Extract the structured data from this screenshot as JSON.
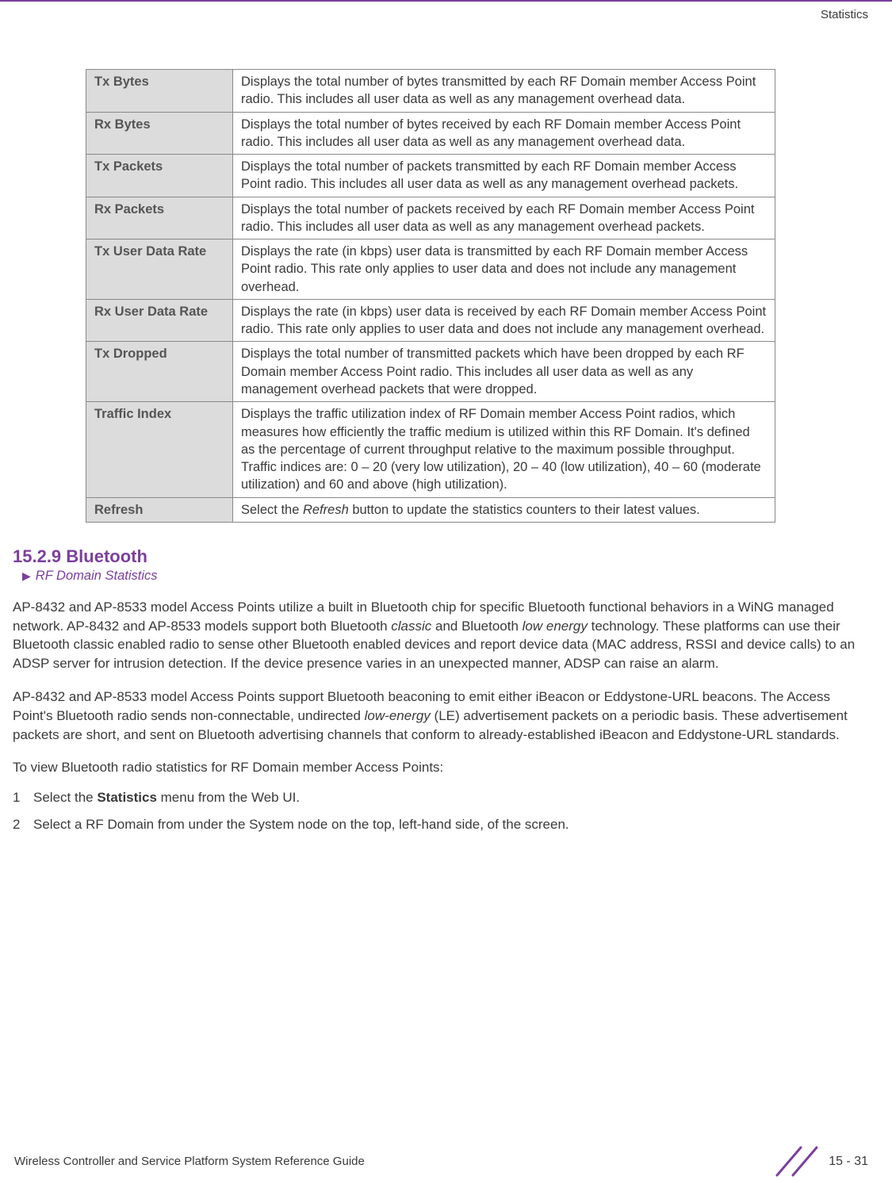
{
  "header": {
    "section_name": "Statistics"
  },
  "table": {
    "rows": [
      {
        "label": "Tx Bytes",
        "desc": "Displays the total number of bytes transmitted by each RF Domain member Access Point radio. This includes all user data as well as any management overhead data."
      },
      {
        "label": "Rx Bytes",
        "desc": "Displays the total number of bytes received by each RF Domain member Access Point radio. This includes all user data as well as any management overhead data."
      },
      {
        "label": "Tx Packets",
        "desc": "Displays the total number of packets transmitted by each RF Domain member Access Point radio. This includes all user data as well as any management overhead packets."
      },
      {
        "label": "Rx Packets",
        "desc": "Displays the total number of packets received by each RF Domain member Access Point radio. This includes all user data as well as any management overhead packets."
      },
      {
        "label": "Tx User Data Rate",
        "desc": "Displays the rate (in kbps) user data is transmitted by each RF Domain member Access Point radio. This rate only applies to user data and does not include any management overhead."
      },
      {
        "label": "Rx User Data Rate",
        "desc": "Displays the rate (in kbps) user data is received by each RF Domain member Access Point radio. This rate only applies to user data and does not include any management overhead."
      },
      {
        "label": "Tx Dropped",
        "desc": "Displays the total number of transmitted packets which have been dropped by each RF Domain member Access Point radio. This includes all user data as well as any management overhead packets that were dropped."
      },
      {
        "label": "Traffic Index",
        "desc": "Displays the traffic utilization index of RF Domain member Access Point radios, which measures how efficiently the traffic medium is utilized within this RF Domain. It's defined as the percentage of current throughput relative to the maximum possible throughput. Traffic indices are: 0 – 20 (very low utilization), 20 – 40 (low utilization), 40 – 60 (moderate utilization) and 60 and above (high utilization)."
      },
      {
        "label": "Refresh",
        "desc_prefix": "Select the ",
        "desc_italic": "Refresh",
        "desc_suffix": " button to update the statistics counters to their latest values."
      }
    ]
  },
  "section": {
    "heading": "15.2.9 Bluetooth",
    "breadcrumb": "RF Domain Statistics"
  },
  "paragraphs": {
    "p1_part1": "AP-8432 and AP-8533 model Access Points utilize a built in Bluetooth chip for specific Bluetooth functional behaviors in a WiNG managed network. AP-8432 and AP-8533 models support both Bluetooth ",
    "p1_italic1": "classic",
    "p1_part2": " and Bluetooth ",
    "p1_italic2": "low energy",
    "p1_part3": " technology. These platforms can use their Bluetooth classic enabled radio to sense other Bluetooth enabled devices and report device data (MAC address, RSSI and device calls) to an ADSP server for intrusion detection. If the device presence varies in an unexpected manner, ADSP can raise an alarm.",
    "p2_part1": "AP-8432 and AP-8533 model Access Points support Bluetooth beaconing to emit either iBeacon or Eddystone-URL beacons. The Access Point's Bluetooth radio sends non-connectable, undirected ",
    "p2_italic1": "low-energy",
    "p2_part2": " (LE) advertisement packets on a periodic basis. These advertisement packets are short, and sent on Bluetooth advertising channels that conform to already-established iBeacon and Eddystone-URL standards.",
    "p3": "To view Bluetooth radio statistics for RF Domain member Access Points:"
  },
  "steps": [
    {
      "num": "1",
      "prefix": "Select the ",
      "bold": "Statistics",
      "suffix": " menu from the Web UI."
    },
    {
      "num": "2",
      "text": "Select a RF Domain from under the System node on the top, left-hand side, of the screen."
    }
  ],
  "footer": {
    "left": "Wireless Controller and Service Platform System Reference Guide",
    "page": "15 - 31"
  }
}
